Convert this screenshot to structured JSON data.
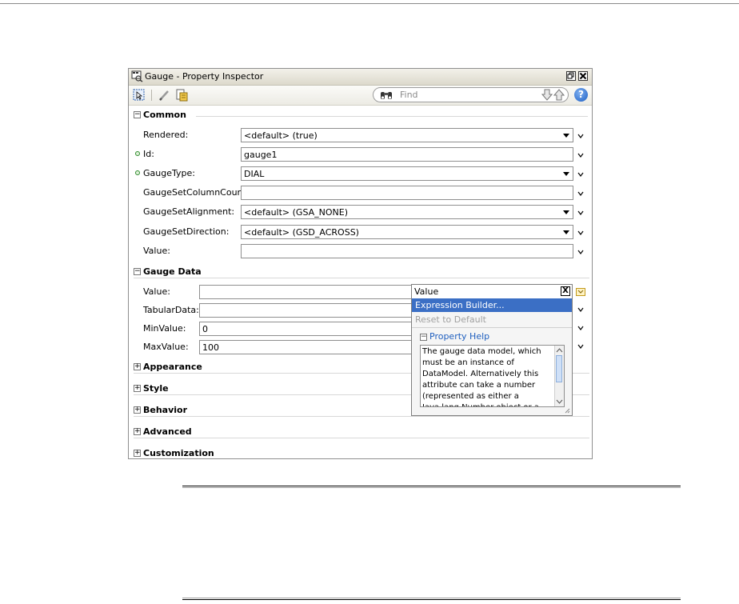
{
  "window": {
    "title": "Gauge - Property Inspector"
  },
  "toolbar": {
    "find_placeholder": "Find",
    "help_label": "?"
  },
  "sections": {
    "common": "Common",
    "gauge_data": "Gauge Data",
    "appearance": "Appearance",
    "style": "Style",
    "behavior": "Behavior",
    "advanced": "Advanced",
    "customization": "Customization"
  },
  "common": {
    "rendered": {
      "label": "Rendered:",
      "value": "<default> (true)"
    },
    "id": {
      "label": "Id:",
      "value": "gauge1"
    },
    "gauge_type": {
      "label": "GaugeType:",
      "value": "DIAL"
    },
    "set_column_count": {
      "label": "GaugeSetColumnCount:",
      "value": ""
    },
    "set_alignment": {
      "label": "GaugeSetAlignment:",
      "value": "<default> (GSA_NONE)"
    },
    "set_direction": {
      "label": "GaugeSetDirection:",
      "value": "<default> (GSD_ACROSS)"
    },
    "value": {
      "label": "Value:",
      "value": ""
    }
  },
  "gauge_data": {
    "value": {
      "label": "Value:",
      "value": ""
    },
    "tabular_data": {
      "label": "TabularData:",
      "value": ""
    },
    "min_value": {
      "label": "MinValue:",
      "value": "0"
    },
    "max_value": {
      "label": "MaxValue:",
      "value": "100"
    }
  },
  "popup": {
    "title": "Value",
    "close": "X",
    "expression_builder": "Expression Builder...",
    "reset_to_default": "Reset to Default",
    "property_help_title": "Property Help",
    "property_help_text": "The gauge data model, which must be an instance of DataModel. Alternatively this attribute can take a number (represented as either a Java.lang.Number object or a"
  },
  "colors": {
    "accent": "#3b6fc5",
    "help_link": "#1f5fbf",
    "required_dot": "#2e8b2e"
  }
}
